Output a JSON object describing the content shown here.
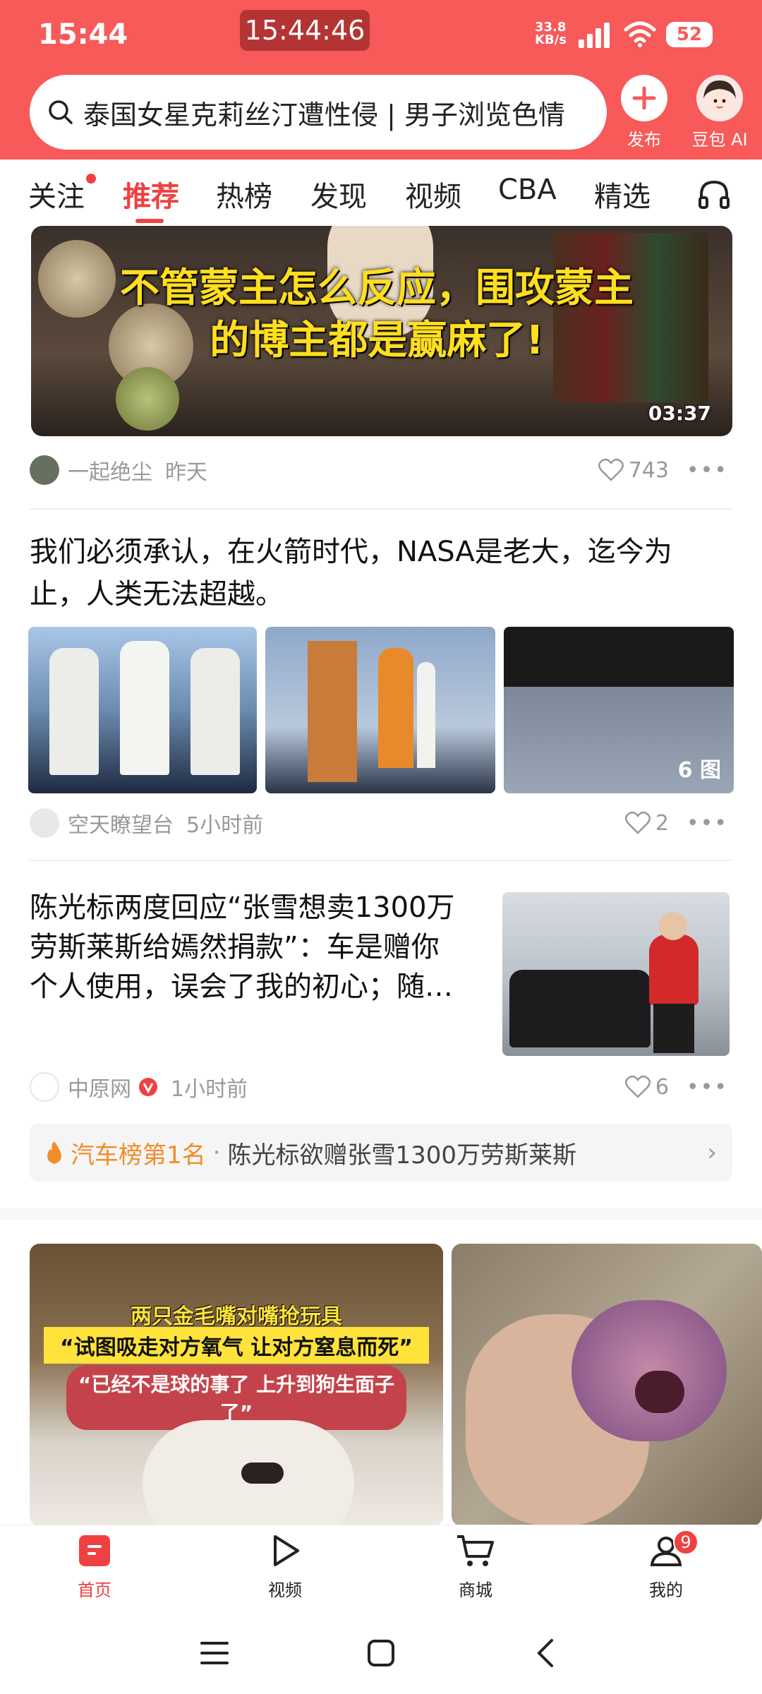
{
  "status_bar": {
    "time": "15:44",
    "clock_pill": "15:44:46",
    "net_speed_value": "33.8",
    "net_speed_unit": "KB/s",
    "battery": "52"
  },
  "header": {
    "search_text": "泰国女星克莉丝汀遭性侵 | 男子浏览色情",
    "publish_label": "发布",
    "ai_label": "豆包 AI"
  },
  "tabs": [
    {
      "label": "关注"
    },
    {
      "label": "推荐"
    },
    {
      "label": "热榜"
    },
    {
      "label": "发现"
    },
    {
      "label": "视频"
    },
    {
      "label": "CBA"
    },
    {
      "label": "精选"
    }
  ],
  "feed": {
    "video_card": {
      "caption_line1": "不管蒙主怎么反应，围攻蒙主",
      "caption_line2": "的博主都是赢麻了!",
      "duration": "03:37",
      "author": "一起绝尘",
      "time": "昨天",
      "likes": "743"
    },
    "article_nasa": {
      "title_line1": "我们必须承认，在火箭时代，NASA是老大，迄今为",
      "title_line2": "止，人类无法超越。",
      "image_count": "6 图",
      "author": "空天瞭望台",
      "time": "5小时前",
      "likes": "2"
    },
    "article_chen": {
      "title_line1": "陈光标两度回应“张雪想卖1300万",
      "title_line2": "劳斯莱斯给嫣然捐款”：车是赠你",
      "title_line3": "个人使用，误会了我的初心；随…",
      "author": "中原网",
      "time": "1小时前",
      "likes": "6"
    },
    "hot_bar": {
      "rank": "汽车榜第1名",
      "sep": "·",
      "text": "陈光标欲赠张雪1300万劳斯莱斯"
    },
    "dog_card": {
      "line1": "两只金毛嘴对嘴抢玩具",
      "line2": "“试图吸走对方氧气 让对方窒息而死”",
      "line3": "“已经不是球的事了 上升到狗生面子了”"
    }
  },
  "bottom_nav": [
    {
      "label": "首页"
    },
    {
      "label": "视频"
    },
    {
      "label": "商城"
    },
    {
      "label": "我的",
      "badge": "9"
    }
  ],
  "colors": {
    "brand_red": "#f85959",
    "active_red": "#f04142",
    "hot_orange": "#f28c28"
  }
}
